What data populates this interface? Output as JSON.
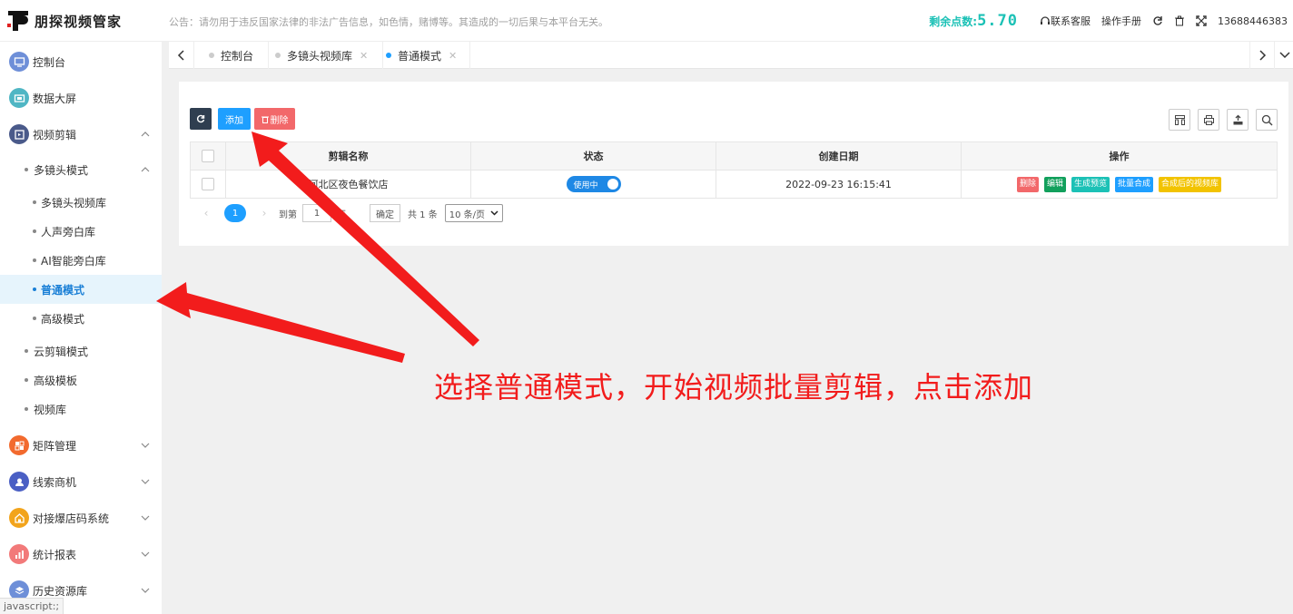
{
  "app": {
    "title": "朋探视频管家"
  },
  "header": {
    "notice": "公告：请勿用于违反国家法律的非法广告信息，如色情，赌博等。其造成的一切后果与本平台无关。",
    "points_label": "剩余点数:",
    "points_value": "5.70",
    "support_label": "联系客服",
    "manual_label": "操作手册",
    "phone": "13688446383"
  },
  "sidebar": {
    "items": [
      {
        "label": "控制台",
        "icon": "monitor-icon",
        "color": "#6e8fd8"
      },
      {
        "label": "数据大屏",
        "icon": "screen-icon",
        "color": "#4fb6c4"
      },
      {
        "label": "视频剪辑",
        "icon": "edit-icon",
        "color": "#4a5a8a"
      }
    ],
    "sub_group": "多镜头模式",
    "sub_items": [
      "多镜头视频库",
      "人声旁白库",
      "AI智能旁白库",
      "普通模式",
      "高级模式"
    ],
    "level2_items": [
      "云剪辑模式",
      "高级模板",
      "视频库"
    ],
    "bottom_items": [
      {
        "label": "矩阵管理",
        "icon": "grid-icon",
        "color": "#f26a2e"
      },
      {
        "label": "线索商机",
        "icon": "clue-icon",
        "color": "#4a5fc4"
      },
      {
        "label": "对接爆店码系统",
        "icon": "shop-icon",
        "color": "#f2a41c"
      },
      {
        "label": "统计报表",
        "icon": "chart-icon",
        "color": "#f27a7a"
      },
      {
        "label": "历史资源库",
        "icon": "archive-icon",
        "color": "#6e8fd8"
      }
    ],
    "status_url": "javascript:;"
  },
  "tabs": [
    {
      "label": "控制台"
    },
    {
      "label": "多镜头视频库"
    },
    {
      "label": "普通模式"
    }
  ],
  "toolbar": {
    "add_label": "添加",
    "delete_label": "删除"
  },
  "table": {
    "columns": [
      "剪辑名称",
      "状态",
      "创建日期",
      "操作"
    ],
    "rows": [
      {
        "name": "河北区夜色餐饮店",
        "status": "使用中",
        "date": "2022-09-23 16:15:41"
      }
    ],
    "actions": [
      {
        "label": "删除",
        "color": "#f2686a"
      },
      {
        "label": "编辑",
        "color": "#12a05c"
      },
      {
        "label": "生成预览",
        "color": "#1cc1b6"
      },
      {
        "label": "批量合成",
        "color": "#1e9fff"
      },
      {
        "label": "合成后的视频库",
        "color": "#f2c300"
      }
    ]
  },
  "pager": {
    "current": "1",
    "goto_label": "到第",
    "goto_value": "1",
    "page_suffix": "页",
    "confirm": "确定",
    "total": "共 1 条",
    "page_size": "10 条/页"
  },
  "annotation": {
    "text": "选择普通模式，开始视频批量剪辑，点击添加",
    "color": "#f21c1c"
  }
}
